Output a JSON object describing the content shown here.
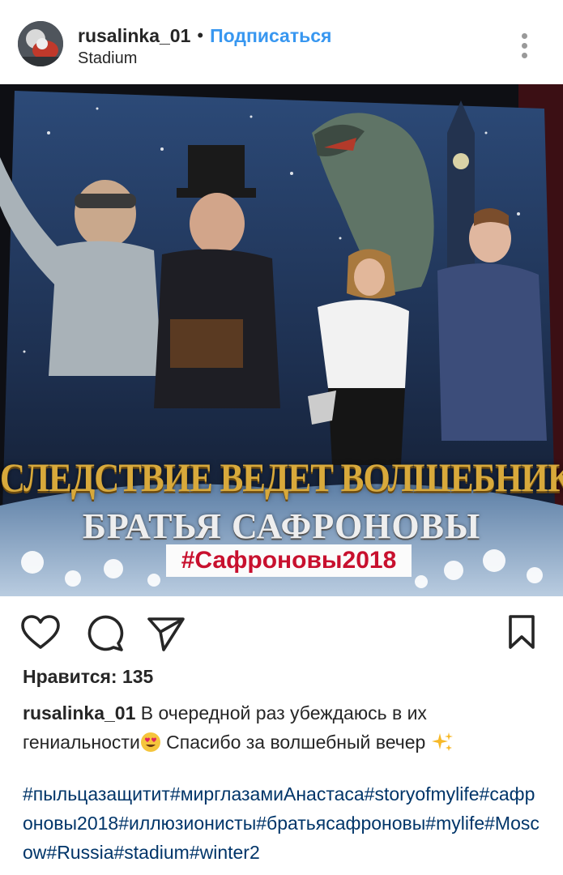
{
  "post": {
    "username": "rusalinka_01",
    "dot": "•",
    "follow_label": "Подписаться",
    "location": "Stadium"
  },
  "photo": {
    "banner_line1": "СЛЕДСТВИЕ ВЕДЕТ ВОЛШЕБНИК",
    "banner_line2": "БРАТЬЯ САФРОНОВЫ",
    "banner_hashtag": "#Сафроновы2018"
  },
  "actions": {
    "icons": [
      "heart-icon",
      "comment-icon",
      "share-icon",
      "bookmark-icon"
    ]
  },
  "likes": {
    "text": "Нравится: 135"
  },
  "caption": {
    "username": "rusalinka_01",
    "text_part1": " В очередной раз убеждаюсь в их гениальности",
    "text_part2": " Спасибо за волшебный вечер ",
    "hashtags": "#пыльцазащитит#мирглазамиАнастаса#storyofmylife#сафроновы2018#иллюзионисты#братьясафроновы#mylife#Moscow#Russia#stadium#winter2"
  },
  "colors": {
    "link_blue": "#3897f0",
    "hashtag_blue": "#003569",
    "text": "#262626"
  }
}
